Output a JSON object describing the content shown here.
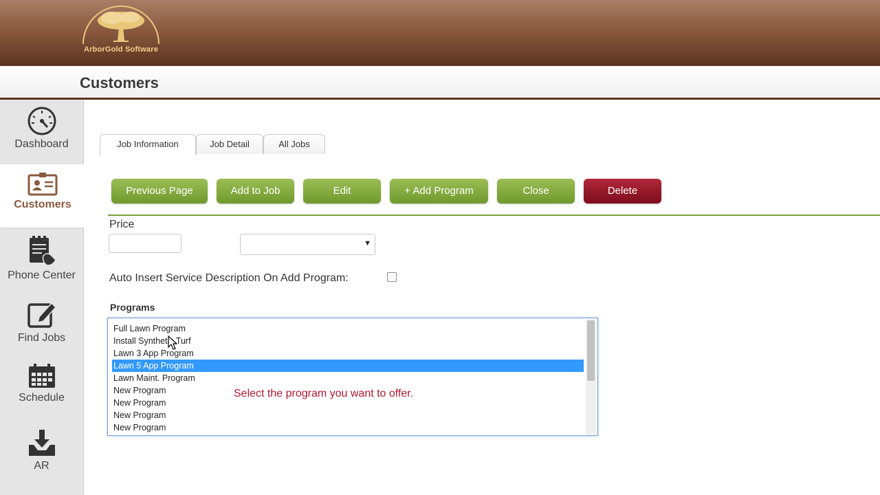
{
  "logo": {
    "text": "ArborGold Software"
  },
  "page_title": "Customers",
  "sidebar": {
    "items": [
      {
        "label": "Dashboard",
        "icon": "dashboard-gauge-icon",
        "active": false
      },
      {
        "label": "Customers",
        "icon": "customer-card-icon",
        "active": true
      },
      {
        "label": "Phone Center",
        "icon": "phone-notepad-icon",
        "active": false
      },
      {
        "label": "Find Jobs",
        "icon": "edit-pencil-icon",
        "active": false
      },
      {
        "label": "Schedule",
        "icon": "calendar-icon",
        "active": false
      },
      {
        "label": "AR",
        "icon": "download-tray-icon",
        "active": false
      }
    ]
  },
  "tabs": [
    {
      "label": "Job Information",
      "active": true
    },
    {
      "label": "Job Detail",
      "active": false
    },
    {
      "label": "All Jobs",
      "active": false
    }
  ],
  "buttons": {
    "previous_page": "Previous Page",
    "add_to_job": "Add to Job",
    "edit": "Edit",
    "add_program": "+ Add Program",
    "close": "Close",
    "delete": "Delete"
  },
  "colors": {
    "action_green": "#7ba338",
    "delete_red": "#9b1728",
    "banner_brown": "#7a4a31",
    "selection_blue": "#3399ff",
    "hint_red": "#b3192f"
  },
  "form": {
    "price_label": "Price",
    "price_value": "",
    "price_select_value": "",
    "auto_insert_label": "Auto Insert Service Description On Add Program:",
    "auto_insert_checked": false,
    "programs_label": "Programs"
  },
  "programs": [
    {
      "label": "Full Lawn Program",
      "selected": false
    },
    {
      "label": "Install Synthetic Turf",
      "selected": false
    },
    {
      "label": "Lawn 3 App Program",
      "selected": false
    },
    {
      "label": "Lawn 5 App Program",
      "selected": true
    },
    {
      "label": "Lawn Maint. Program",
      "selected": false
    },
    {
      "label": "New Program",
      "selected": false
    },
    {
      "label": "New Program",
      "selected": false
    },
    {
      "label": "New Program",
      "selected": false
    },
    {
      "label": "New Program",
      "selected": false
    }
  ],
  "hint_text": "Select the program you want to offer."
}
